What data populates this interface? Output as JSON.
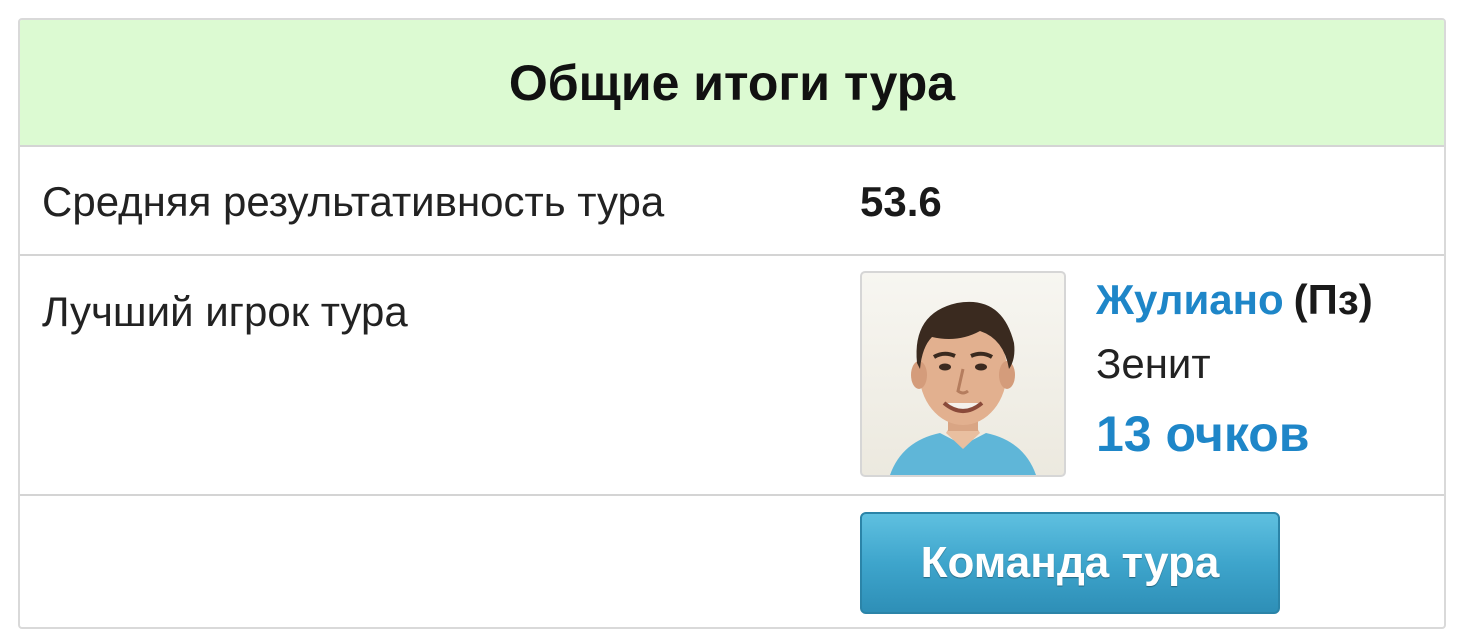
{
  "panel": {
    "title": "Общие итоги тура"
  },
  "average": {
    "label": "Средняя результативность тура",
    "value": "53.6"
  },
  "best_player": {
    "label": "Лучший игрок тура",
    "name": "Жулиано",
    "position": "(Пз)",
    "team": "Зенит",
    "points": "13 очков"
  },
  "actions": {
    "team_of_round_label": "Команда тура"
  },
  "colors": {
    "header_bg": "#dcfad2",
    "link_blue": "#1e86c8",
    "button_blue": "#3ea5cc"
  }
}
